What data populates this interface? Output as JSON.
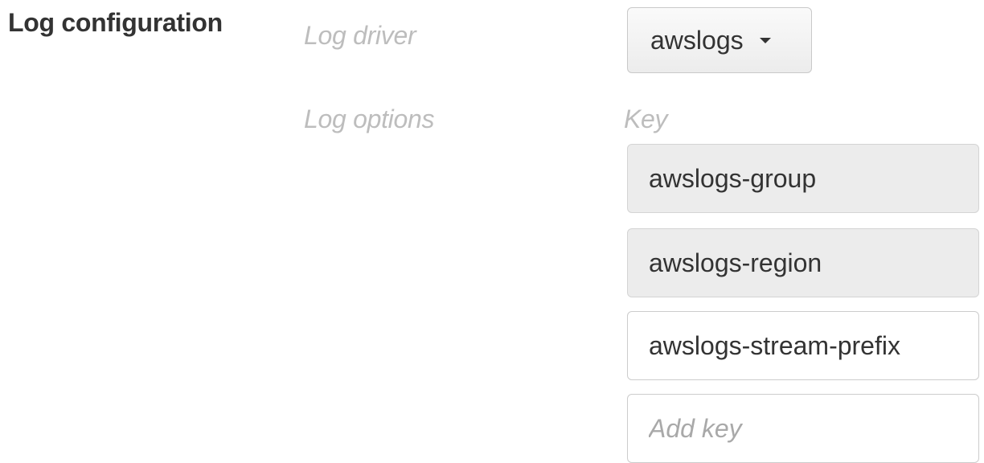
{
  "section": {
    "title": "Log configuration"
  },
  "log_driver": {
    "label": "Log driver",
    "selected": "awslogs"
  },
  "log_options": {
    "label": "Log options",
    "key_header": "Key",
    "keys": [
      {
        "value": "awslogs-group",
        "readonly": true
      },
      {
        "value": "awslogs-region",
        "readonly": true
      },
      {
        "value": "awslogs-stream-prefix",
        "readonly": false
      }
    ],
    "add_key_placeholder": "Add key"
  },
  "icons": {
    "driver_dropdown": "caret-down-icon"
  }
}
